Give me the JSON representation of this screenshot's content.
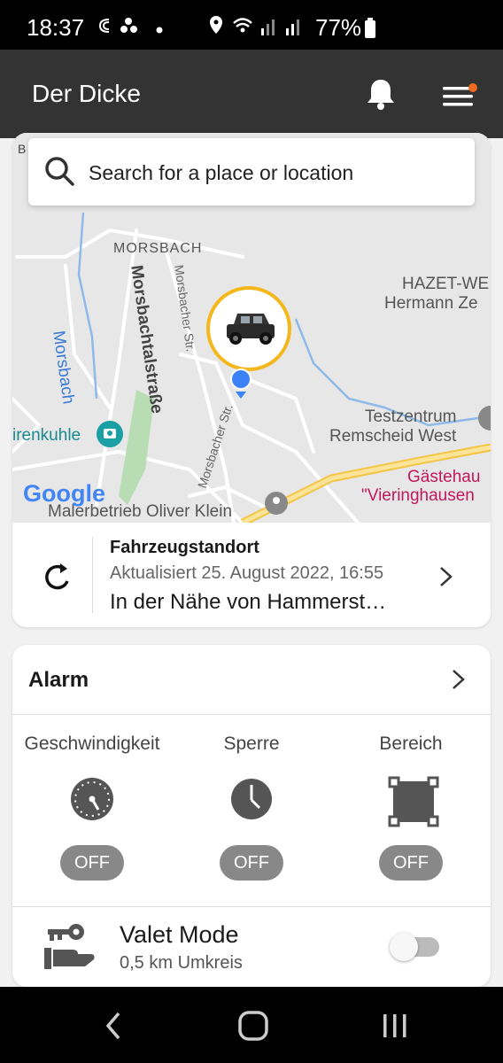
{
  "status_bar": {
    "time": "18:37",
    "battery": "77%"
  },
  "app_bar": {
    "title": "Der Dicke"
  },
  "search": {
    "placeholder": "Search for a place or location"
  },
  "map": {
    "labels": {
      "morsbach": "MORSBACH",
      "morsbach_river": "Morsbach",
      "morsbachtalstrasse": "Morsbachtalstraße",
      "morsbacher_str_1": "Morsbacher Str.",
      "morsbacher_str_2": "Morsbacher Str.",
      "hazet_1": "HAZET-WE",
      "hazet_2": "Hermann Ze",
      "testzentrum_1": "Testzentrum",
      "testzentrum_2": "Remscheid West",
      "renkuhle": "irenkuhle",
      "gastehaus_1": "Gästehau",
      "gastehaus_2": "\"Vieringhausen",
      "malerbetrieb": "Malerbetrieb Oliver Klein",
      "google": "Google",
      "edge_b": "B"
    }
  },
  "location": {
    "title": "Fahrzeugstandort",
    "updated": "Aktualisiert 25. August 2022, 16:55",
    "address": "In der Nähe von Hammerst…"
  },
  "alarm": {
    "title": "Alarm",
    "options": [
      {
        "label": "Geschwindigkeit",
        "state": "OFF"
      },
      {
        "label": "Sperre",
        "state": "OFF"
      },
      {
        "label": "Bereich",
        "state": "OFF"
      }
    ]
  },
  "valet": {
    "title": "Valet Mode",
    "subtitle": "0,5 km Umkreis",
    "enabled": false
  },
  "colors": {
    "accent": "#f26a21",
    "marker_ring": "#f5b81c",
    "map_pin": "#3b82f6",
    "toggle_off": "#bbbbbb"
  }
}
